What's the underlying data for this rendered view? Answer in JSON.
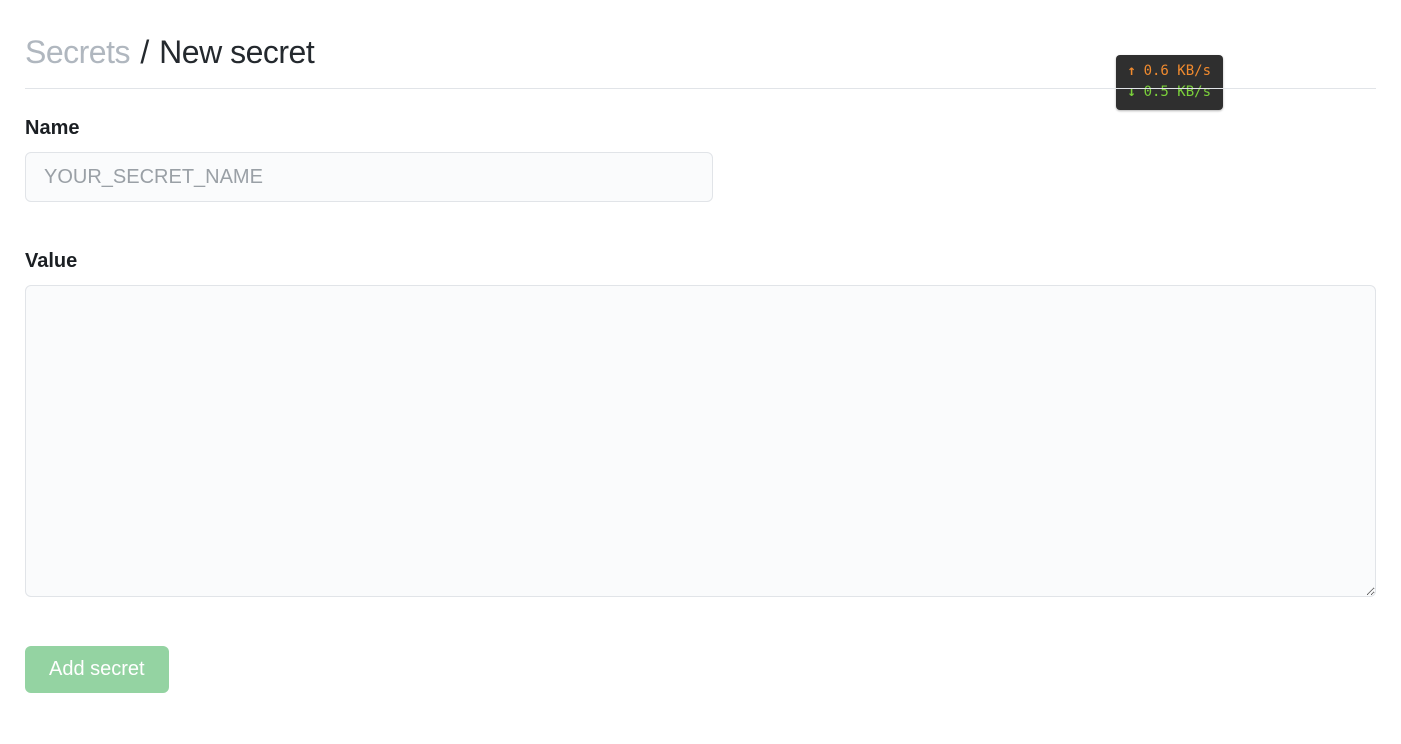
{
  "breadcrumb": {
    "parent": "Secrets",
    "separator": "/",
    "current": "New secret"
  },
  "network": {
    "upload": "0.6 KB/s",
    "download": "0.5 KB/s"
  },
  "form": {
    "name_label": "Name",
    "name_placeholder": "YOUR_SECRET_NAME",
    "name_value": "",
    "value_label": "Value",
    "value_content": "",
    "submit_label": "Add secret"
  }
}
